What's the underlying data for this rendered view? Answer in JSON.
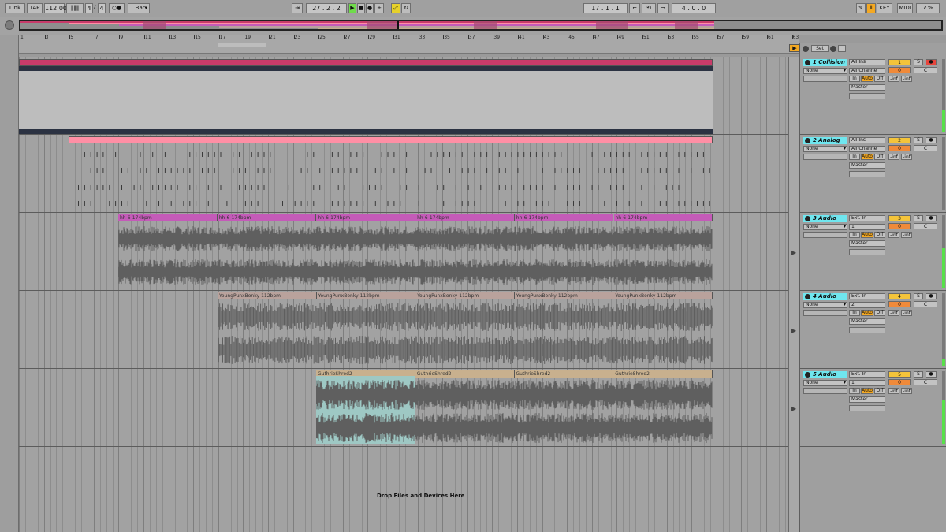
{
  "transport": {
    "link": "Link",
    "tap": "TAP",
    "tempo": "112.00",
    "nudge": "‖‖‖",
    "sig_num": "4",
    "sig_den": "4",
    "metro": "○●",
    "quantize": "1 Bar",
    "follow_icon": "follow-arrow-icon",
    "position": "27 .   2 .   2",
    "loop_start": "17 .   1 .   1",
    "loop_length": "4 .   0 .   0",
    "key": "KEY",
    "midi": "MIDI",
    "cpu": "7 %"
  },
  "ruler": {
    "bars": [
      "1",
      "3",
      "5",
      "7",
      "9",
      "11",
      "13",
      "15",
      "17",
      "19",
      "21",
      "23",
      "25",
      "27",
      "29",
      "31",
      "33",
      "35",
      "37",
      "39",
      "41",
      "43",
      "45",
      "47",
      "49",
      "51",
      "53",
      "55",
      "57",
      "59",
      "61",
      "63"
    ]
  },
  "tracks": [
    {
      "name": "1 Collision",
      "input_type": "All Ins",
      "input_channel": "All Channe",
      "monitor": [
        "In",
        "Auto",
        "Off"
      ],
      "output": "Master",
      "fx": "None",
      "number": "1",
      "pan": "C",
      "vol": "0",
      "db1": "-inf",
      "db2": "-inf",
      "solo": "S",
      "arm": true,
      "clips": []
    },
    {
      "name": "2 Analog",
      "input_type": "All Ins",
      "input_channel": "All Channe",
      "monitor": [
        "In",
        "Auto",
        "Off"
      ],
      "output": "Master",
      "fx": "None",
      "number": "2",
      "pan": "C",
      "vol": "0",
      "db1": "-inf",
      "db2": "-inf",
      "solo": "S",
      "arm": false,
      "clips": []
    },
    {
      "name": "3 Audio",
      "input_type": "Ext. In",
      "input_channel": "1",
      "monitor": [
        "In",
        "Auto",
        "Off"
      ],
      "output": "Master",
      "fx": "None",
      "number": "3",
      "pan": "C",
      "vol": "0",
      "db1": "-inf",
      "db2": "-inf",
      "solo": "S",
      "arm": false,
      "clips": [
        "hh-6-174bpm",
        "hh-6-174bpm",
        "hh-6-174bpm",
        "hh-6-174bpm",
        "hh-6-174bpm",
        "hh-6-174bpm"
      ]
    },
    {
      "name": "4 Audio",
      "input_type": "Ext. In",
      "input_channel": "2",
      "monitor": [
        "In",
        "Auto",
        "Off"
      ],
      "output": "Master",
      "fx": "None",
      "number": "4",
      "pan": "C",
      "vol": "0",
      "db1": "-inf",
      "db2": "-inf",
      "solo": "S",
      "arm": false,
      "clips": [
        "YoungPunxBonky-112bpm",
        "YoungPunxBonky-112bpm",
        "YoungPunxBonky-112bpm",
        "YoungPunxBonky-112bpm",
        "YoungPunxBonky-112bpm"
      ]
    },
    {
      "name": "5 Audio",
      "input_type": "Ext. In",
      "input_channel": "1",
      "monitor": [
        "In",
        "Auto",
        "Off"
      ],
      "output": "Master",
      "fx": "None",
      "number": "5",
      "pan": "C",
      "vol": "0",
      "db1": "-inf",
      "db2": "-inf",
      "solo": "S",
      "arm": false,
      "clips": [
        "GuthrieShred2",
        "GuthrieShred2",
        "GuthrieShred2",
        "GuthrieShred2"
      ]
    }
  ],
  "mixer_header": {
    "set": "Set"
  },
  "drop_hint": "Drop Files and Devices Here",
  "colors": {
    "collision": "#c83b6a",
    "analog": "#ff8fa5",
    "hh": "#c45bb8",
    "young": "#b9a29c",
    "guthrie": "#c8b08e",
    "track_name": "#6fe6ef",
    "number": "#f4c43a",
    "vol": "#f08a3a",
    "meter": "#58e04a"
  }
}
